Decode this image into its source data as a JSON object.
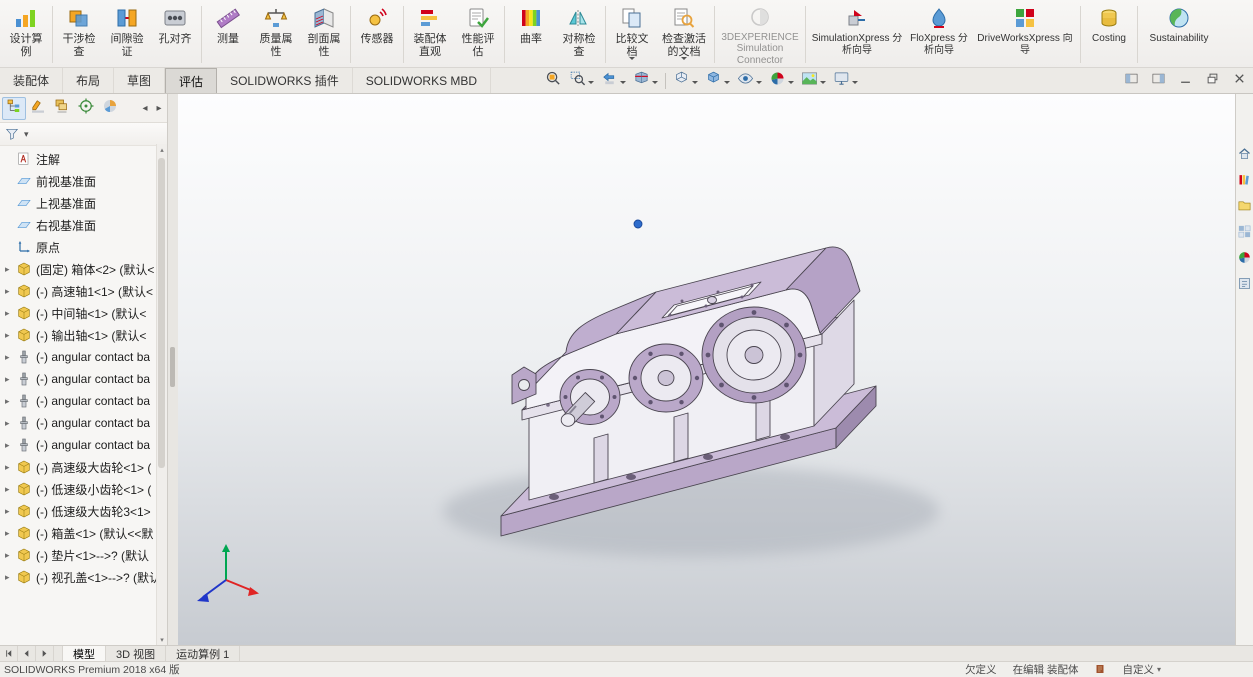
{
  "ribbon": {
    "groups": [
      {
        "buttons": [
          {
            "id": "design-study",
            "icon": "design-study-icon",
            "label": "设计算例"
          }
        ]
      },
      {
        "buttons": [
          {
            "id": "interference-check",
            "icon": "interference-check-icon",
            "label": "干涉检查"
          },
          {
            "id": "clearance-verification",
            "icon": "clearance-verification-icon",
            "label": "间隙验证"
          },
          {
            "id": "hole-alignment",
            "icon": "hole-alignment-icon",
            "label": "孔对齐"
          }
        ]
      },
      {
        "buttons": [
          {
            "id": "measure",
            "icon": "measure-icon",
            "label": "测量"
          },
          {
            "id": "mass-properties",
            "icon": "mass-properties-icon",
            "label": "质量属性"
          },
          {
            "id": "section-properties",
            "icon": "section-properties-icon",
            "label": "剖面属性"
          }
        ]
      },
      {
        "buttons": [
          {
            "id": "sensor",
            "icon": "sensor-icon",
            "label": "传感器"
          }
        ]
      },
      {
        "buttons": [
          {
            "id": "assembly-visualization",
            "icon": "assembly-visualization-icon",
            "label": "装配体直观"
          },
          {
            "id": "performance-evaluation",
            "icon": "performance-evaluation-icon",
            "label": "性能评估"
          }
        ]
      },
      {
        "buttons": [
          {
            "id": "curvature",
            "icon": "curvature-icon",
            "label": "曲率"
          },
          {
            "id": "symmetry-check",
            "icon": "symmetry-check-icon",
            "label": "对称检查"
          }
        ]
      },
      {
        "buttons": [
          {
            "id": "compare-documents",
            "icon": "compare-documents-icon",
            "label": "比较文档",
            "caret": true
          },
          {
            "id": "check-active-document",
            "icon": "check-active-document-icon",
            "label": "检查激活的文档",
            "caret": true
          }
        ]
      },
      {
        "buttons": [
          {
            "id": "3dexperience-connector",
            "icon": "3dexperience-icon",
            "label": "3DEXPERIENCE Simulation Connector",
            "disabled": true
          }
        ]
      },
      {
        "buttons": [
          {
            "id": "simulationxpress",
            "icon": "simulationxpress-icon",
            "label": "SimulationXpress 分析向导"
          },
          {
            "id": "floxpress",
            "icon": "floxpress-icon",
            "label": "FloXpress 分析向导"
          },
          {
            "id": "driveworksxpress",
            "icon": "driveworksxpress-icon",
            "label": "DriveWorksXpress 向导"
          }
        ]
      },
      {
        "buttons": [
          {
            "id": "costing",
            "icon": "costing-icon",
            "label": "Costing"
          }
        ]
      },
      {
        "buttons": [
          {
            "id": "sustainability",
            "icon": "sustainability-icon",
            "label": "Sustainability"
          }
        ]
      }
    ]
  },
  "command_tabs": [
    {
      "label": "装配体",
      "active": false
    },
    {
      "label": "布局",
      "active": false
    },
    {
      "label": "草图",
      "active": false
    },
    {
      "label": "评估",
      "active": true
    },
    {
      "label": "SOLIDWORKS 插件",
      "active": false
    },
    {
      "label": "SOLIDWORKS MBD",
      "active": false
    }
  ],
  "headsup": [
    {
      "icon": "zoom-fit-icon"
    },
    {
      "icon": "zoom-area-icon",
      "caret": true
    },
    {
      "icon": "previous-view-icon",
      "caret": true
    },
    {
      "icon": "section-view-icon",
      "caret": true
    },
    {
      "sep": true
    },
    {
      "icon": "view-orientation-icon",
      "caret": true
    },
    {
      "icon": "display-style-icon",
      "caret": true
    },
    {
      "icon": "hide-show-icon",
      "caret": true
    },
    {
      "icon": "edit-appearance-icon",
      "caret": true
    },
    {
      "icon": "apply-scene-icon",
      "caret": true
    },
    {
      "icon": "view-settings-icon",
      "caret": true
    }
  ],
  "window_controls": [
    {
      "icon": "collapse-pane-icon"
    },
    {
      "icon": "expand-pane-icon"
    },
    {
      "icon": "minimize-icon"
    },
    {
      "icon": "restore-icon"
    },
    {
      "icon": "close-icon"
    }
  ],
  "feature_panel": {
    "tabs": [
      {
        "icon": "featuremanager-icon",
        "active": true
      },
      {
        "icon": "propertymanager-icon",
        "active": false
      },
      {
        "icon": "configurationmanager-icon",
        "active": false
      },
      {
        "icon": "dimxpertmanager-icon",
        "active": false
      },
      {
        "icon": "displaymanager-icon",
        "active": false
      }
    ],
    "filter_icon": "filter-icon",
    "items": [
      {
        "icon": "annotations-icon",
        "label": "注解",
        "expandable": false
      },
      {
        "icon": "plane-icon",
        "label": "前视基准面",
        "expandable": false
      },
      {
        "icon": "plane-icon",
        "label": "上视基准面",
        "expandable": false
      },
      {
        "icon": "plane-icon",
        "label": "右视基准面",
        "expandable": false
      },
      {
        "icon": "origin-icon",
        "label": "原点",
        "expandable": false
      },
      {
        "icon": "component-icon",
        "label": "(固定) 箱体<2> (默认<",
        "expandable": true
      },
      {
        "icon": "component-icon",
        "label": "(-) 高速轴1<1> (默认<",
        "expandable": true
      },
      {
        "icon": "component-icon",
        "label": "(-) 中间轴<1> (默认<",
        "expandable": true
      },
      {
        "icon": "component-icon",
        "label": "(-) 输出轴<1> (默认<",
        "expandable": true
      },
      {
        "icon": "bearing-icon",
        "label": "(-) angular contact ba",
        "expandable": true
      },
      {
        "icon": "bearing-icon",
        "label": "(-) angular contact ba",
        "expandable": true
      },
      {
        "icon": "bearing-icon",
        "label": "(-) angular contact ba",
        "expandable": true
      },
      {
        "icon": "bearing-icon",
        "label": "(-) angular contact ba",
        "expandable": true
      },
      {
        "icon": "bearing-icon",
        "label": "(-) angular contact ba",
        "expandable": true
      },
      {
        "icon": "component-icon",
        "label": "(-) 高速级大齿轮<1> (",
        "expandable": true
      },
      {
        "icon": "component-icon",
        "label": "(-) 低速级小齿轮<1> (",
        "expandable": true
      },
      {
        "icon": "component-icon",
        "label": "(-) 低速级大齿轮3<1>",
        "expandable": true
      },
      {
        "icon": "component-icon",
        "label": "(-) 箱盖<1> (默认<<默",
        "expandable": true
      },
      {
        "icon": "component-icon",
        "label": "(-) 垫片<1>-->? (默认",
        "expandable": true
      },
      {
        "icon": "component-icon",
        "label": "(-) 视孔盖<1>-->? (默认",
        "expandable": true
      }
    ]
  },
  "viewport": {
    "background_top": "#fdfdfe",
    "background_bottom": "#c7cbd1",
    "model_color": "#b9a7c8",
    "triad": {
      "x_color": "#e02424",
      "y_color": "#00a651",
      "z_color": "#2036c9"
    }
  },
  "task_pane": [
    {
      "icon": "home-icon"
    },
    {
      "icon": "design-library-icon"
    },
    {
      "icon": "file-explorer-icon"
    },
    {
      "icon": "view-palette-icon"
    },
    {
      "icon": "appearances-icon"
    },
    {
      "icon": "custom-properties-icon"
    }
  ],
  "bottom_tabs": {
    "nav": [
      "nav-first-icon",
      "nav-prev-icon",
      "nav-next-icon"
    ],
    "tabs": [
      {
        "label": "模型",
        "active": true
      },
      {
        "label": "3D 视图",
        "active": false
      },
      {
        "label": "运动算例 1",
        "active": false
      }
    ]
  },
  "status_bar": {
    "left_text": "SOLIDWORKS Premium 2018 x64 版",
    "state": "欠定义",
    "editing": "在编辑 装配体",
    "customize": "自定义"
  }
}
